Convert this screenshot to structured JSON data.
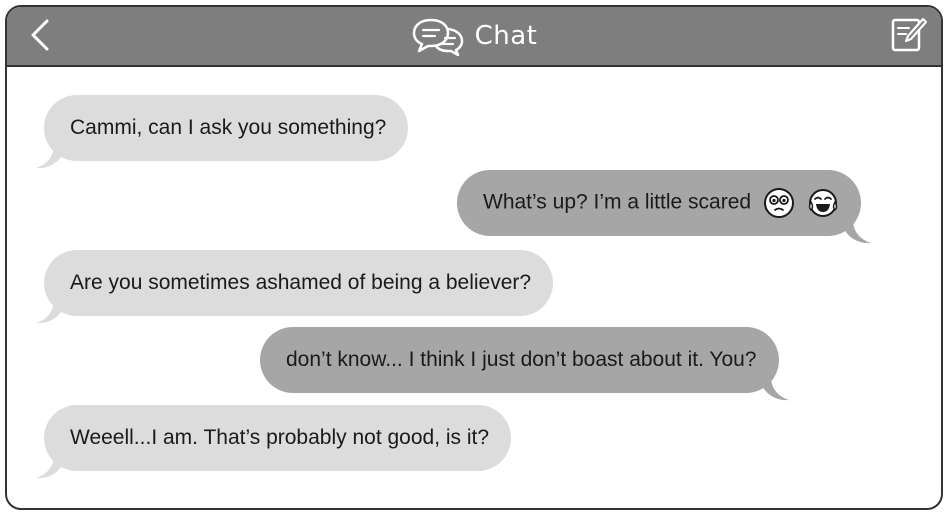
{
  "header": {
    "title": "Chat",
    "back_icon": "chevron-left-icon",
    "chat_icon": "chat-bubbles-icon",
    "compose_icon": "compose-icon"
  },
  "messages": [
    {
      "side": "incoming",
      "text": "Cammi, can I ask you something?"
    },
    {
      "side": "outgoing",
      "text": "What’s up? I’m a little scared",
      "emojis": [
        "worried-face-icon",
        "laughing-tears-icon"
      ]
    },
    {
      "side": "incoming",
      "text": "Are you sometimes ashamed of being a believer?"
    },
    {
      "side": "outgoing",
      "text": "don’t know... I think I just don’t boast about it. You?"
    },
    {
      "side": "incoming",
      "text": "Weeell...I am. That’s probably not good, is it?"
    }
  ],
  "colors": {
    "titlebar": "#7e7e7e",
    "incoming_bubble": "#dcdcdc",
    "outgoing_bubble": "#a6a6a6",
    "border": "#333333"
  }
}
